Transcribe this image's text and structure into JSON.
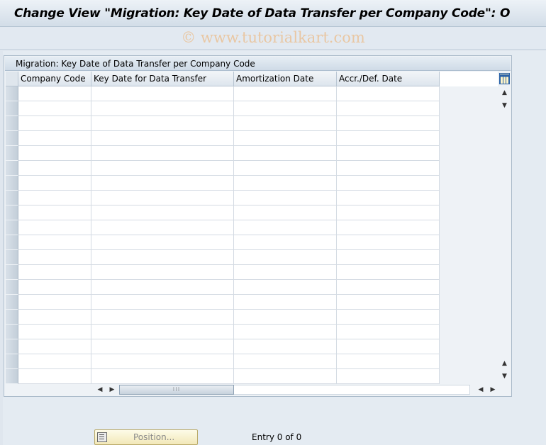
{
  "window": {
    "title": "Change View \"Migration: Key Date of Data Transfer per Company Code\": O",
    "watermark": "© www.tutorialkart.com"
  },
  "table": {
    "title": "Migration: Key Date of Data Transfer per Company Code",
    "columns": [
      {
        "label": "Company Code"
      },
      {
        "label": "Key Date for Data Transfer"
      },
      {
        "label": "Amortization Date"
      },
      {
        "label": "Accr./Def. Date"
      }
    ],
    "rows": []
  },
  "footer": {
    "position_label": "Position...",
    "entry_count": "Entry 0 of 0"
  },
  "icons": {
    "column_config": "table-settings-icon",
    "scroll_up": "triangle-up-icon",
    "scroll_down": "triangle-down-icon",
    "scroll_left": "triangle-left-icon",
    "scroll_right": "triangle-right-icon",
    "position": "position-list-icon"
  },
  "colors": {
    "title_bar": "#d2dde8",
    "grid_border": "#d4dbe3",
    "header_bg": "#dde5ed",
    "row_selector": "#c3ced9",
    "button_bg": "#f2e8b8"
  }
}
